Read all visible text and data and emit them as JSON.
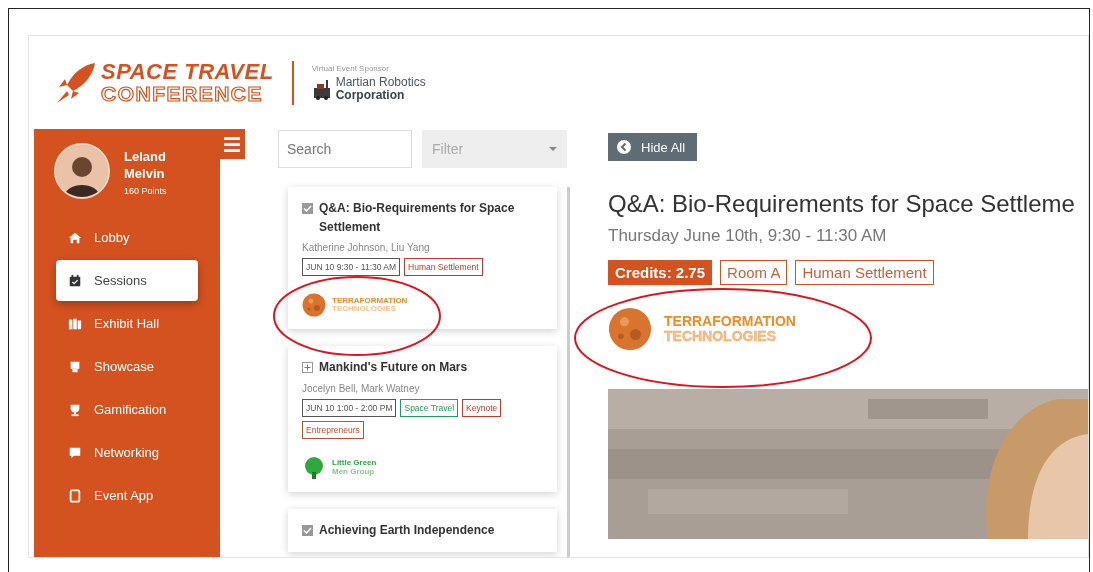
{
  "header": {
    "logo": {
      "line_1": "SPACE TRAVEL",
      "line_2": "CONFERENCE"
    },
    "sponsor": {
      "caption": "Virtual Event Sponsor",
      "name_1": "Martian Robotics",
      "name_2": "Corporation"
    }
  },
  "sidebar": {
    "user": {
      "first_name": "Leland",
      "last_name": "Melvin",
      "points": "160 Points"
    },
    "items": [
      {
        "label": "Lobby",
        "selected": false
      },
      {
        "label": "Sessions",
        "selected": true
      },
      {
        "label": "Exhibit Hall",
        "selected": false
      },
      {
        "label": "Showcase",
        "selected": false
      },
      {
        "label": "Gamification",
        "selected": false
      },
      {
        "label": "Networking",
        "selected": false
      },
      {
        "label": "Event App",
        "selected": false
      }
    ]
  },
  "sessions": {
    "search": {
      "placeholder": "Search"
    },
    "filter": {
      "placeholder": "Filter"
    },
    "cards": [
      {
        "title": "Q&A: Bio-Requirements for Space Settlement",
        "checked": true,
        "speakers": "Katherine Johnson, Liu Yang",
        "tags": [
          {
            "label": "JUN 10 9:30 - 11:30 AM",
            "color": "#555555"
          },
          {
            "label": "Human Settlement",
            "color": "#c0392b"
          }
        ],
        "sponsor": {
          "kind": "planet",
          "line_1": "TERRAFORMATION",
          "line_2": "TECHNOLOGIES"
        }
      },
      {
        "title": "Mankind's Future on Mars",
        "checked": false,
        "speakers": "Jocelyn Bell, Mark Watney",
        "tags": [
          {
            "label": "JUN 10 1:00 - 2:00 PM",
            "color": "#555555"
          },
          {
            "label": "Space Travel",
            "color": "#1e9e5a"
          },
          {
            "label": "Keynote",
            "color": "#c0392b"
          },
          {
            "label": "Entrepreneurs",
            "color": "#b5522f"
          }
        ],
        "sponsor": {
          "kind": "tree",
          "line_1": "Little Green",
          "line_2": "Men Group"
        }
      },
      {
        "title": "Achieving Earth Independence",
        "checked": true
      }
    ]
  },
  "detail": {
    "hide_button": "Hide All",
    "title": "Q&A: Bio-Requirements for Space Settleme",
    "date": "Thursday June 10th, 9:30 - 11:30 AM",
    "badges": [
      {
        "label": "Credits: 2.75",
        "kind": "filled"
      },
      {
        "label": "Room A",
        "kind": "outline"
      },
      {
        "label": "Human Settlement",
        "kind": "outline"
      }
    ],
    "sponsor": {
      "kind": "planet",
      "line_1": "TERRAFORMATION",
      "line_2": "TECHNOLOGIES"
    }
  }
}
